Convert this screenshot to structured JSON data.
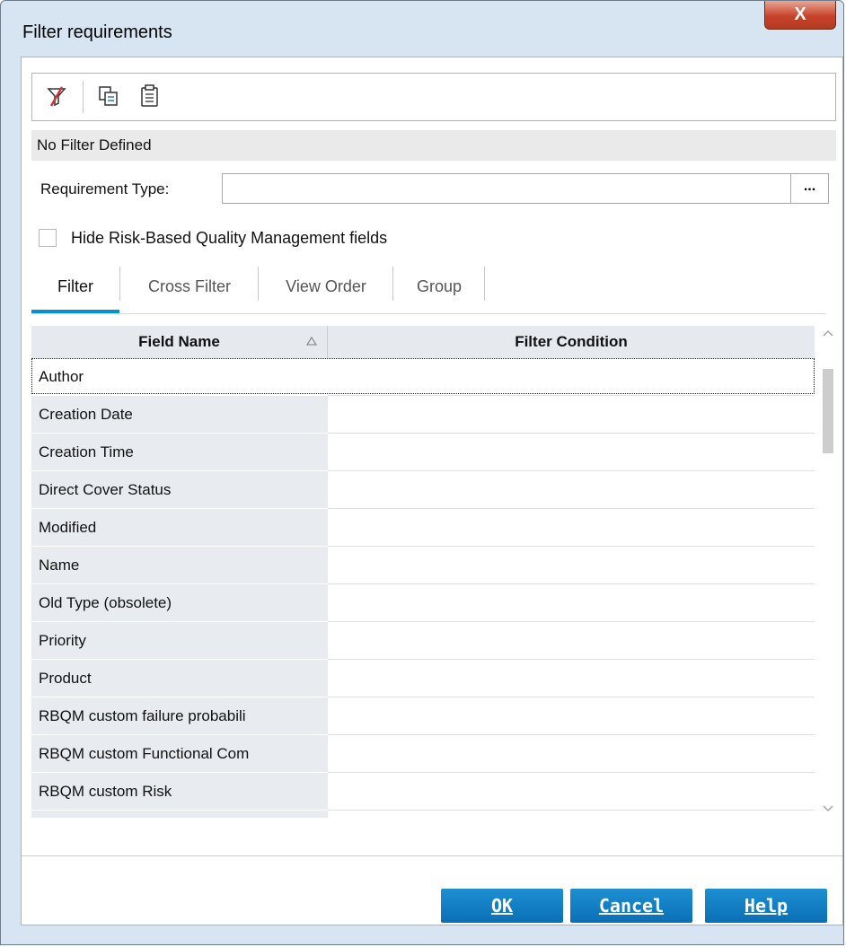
{
  "window": {
    "title": "Filter requirements",
    "close_label": "X"
  },
  "toolbar": {
    "icons": [
      "clear-filter-icon",
      "copy-icon",
      "paste-icon"
    ]
  },
  "status": {
    "text": "No Filter Defined"
  },
  "requirement_type": {
    "label": "Requirement Type:",
    "value": "",
    "browse_label": "..."
  },
  "hide_rbqm": {
    "label": "Hide Risk-Based Quality Management fields",
    "checked": false
  },
  "tabs": [
    {
      "label": "Filter",
      "active": true
    },
    {
      "label": "Cross Filter",
      "active": false
    },
    {
      "label": "View Order",
      "active": false
    },
    {
      "label": "Group",
      "active": false
    }
  ],
  "grid": {
    "columns": [
      "Field Name",
      "Filter Condition"
    ],
    "rows": [
      {
        "field": "Author",
        "condition": ""
      },
      {
        "field": "Creation Date",
        "condition": ""
      },
      {
        "field": "Creation Time",
        "condition": ""
      },
      {
        "field": "Direct Cover Status",
        "condition": ""
      },
      {
        "field": "Modified",
        "condition": ""
      },
      {
        "field": "Name",
        "condition": ""
      },
      {
        "field": "Old Type (obsolete)",
        "condition": ""
      },
      {
        "field": "Priority",
        "condition": ""
      },
      {
        "field": "Product",
        "condition": ""
      },
      {
        "field": "RBQM custom failure probabili",
        "condition": ""
      },
      {
        "field": "RBQM custom Functional Com",
        "condition": ""
      },
      {
        "field": "RBQM custom Risk",
        "condition": ""
      },
      {
        "field": "",
        "condition": ""
      }
    ]
  },
  "buttons": {
    "ok": "OK",
    "cancel": "Cancel",
    "help": "Help"
  },
  "colors": {
    "accent": "#0b7cc4",
    "close": "#c7432a"
  }
}
